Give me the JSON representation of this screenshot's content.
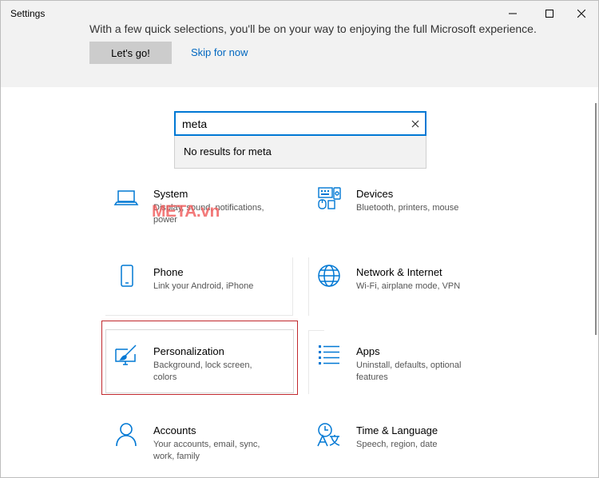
{
  "window": {
    "title": "Settings"
  },
  "banner": {
    "message": "With a few quick selections, you'll be on your way to enjoying the full Microsoft experience.",
    "primary_button": "Let's go!",
    "skip_link": "Skip for now"
  },
  "search": {
    "value": "meta",
    "no_results": "No results for meta"
  },
  "watermark": "META.vn",
  "tiles": [
    {
      "title": "System",
      "description": "Display, sound, notifications, power",
      "icon": "laptop-icon"
    },
    {
      "title": "Devices",
      "description": "Bluetooth, printers, mouse",
      "icon": "devices-icon"
    },
    {
      "title": "Phone",
      "description": "Link your Android, iPhone",
      "icon": "phone-icon"
    },
    {
      "title": "Network & Internet",
      "description": "Wi-Fi, airplane mode, VPN",
      "icon": "globe-icon"
    },
    {
      "title": "Personalization",
      "description": "Background, lock screen, colors",
      "icon": "paintbrush-icon"
    },
    {
      "title": "Apps",
      "description": "Uninstall, defaults, optional features",
      "icon": "apps-list-icon"
    },
    {
      "title": "Accounts",
      "description": "Your accounts, email, sync, work, family",
      "icon": "person-icon"
    },
    {
      "title": "Time & Language",
      "description": "Speech, region, date",
      "icon": "time-language-icon"
    }
  ],
  "colors": {
    "accent": "#0078d4",
    "highlight_border": "#c0282d",
    "link": "#0067c0"
  }
}
